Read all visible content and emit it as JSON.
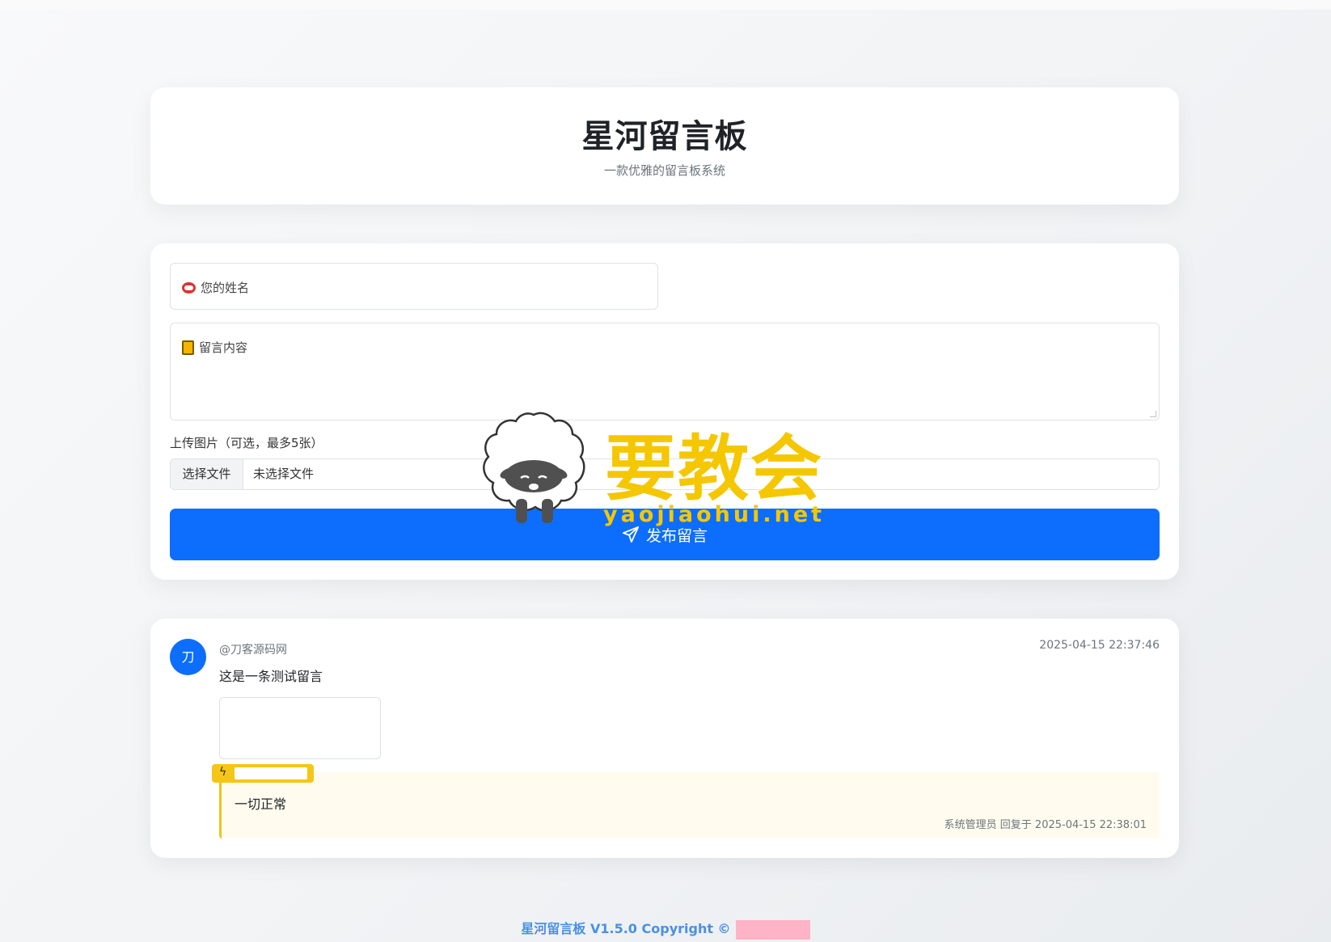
{
  "header": {
    "title": "星河留言板",
    "subtitle": "一款优雅的留言板系统"
  },
  "form": {
    "name_placeholder": "您的姓名",
    "content_placeholder": "留言内容",
    "upload_label": "上传图片（可选，最多5张）",
    "file_button": "选择文件",
    "file_status": "未选择文件",
    "submit_label": "发布留言",
    "name_icon": "face-mouth-icon",
    "content_icon": "notebook-icon",
    "submit_icon": "send-icon"
  },
  "messages": [
    {
      "avatar_char": "刀",
      "author": "@刀客源码网",
      "time": "2025-04-15 22:37:46",
      "text": "这是一条测试留言",
      "reply": {
        "text": "一切正常",
        "meta": "系统管理员 回复于 2025-04-15 22:38:01"
      }
    }
  ],
  "watermark": {
    "brand": "要教会",
    "url": "yaojiaohui.net"
  },
  "footer": {
    "text": "星河留言板 V1.5.0 Copyright ©"
  },
  "colors": {
    "primary": "#0d6efd",
    "reply_accent": "#f5c518",
    "watermark": "#f5c700"
  }
}
